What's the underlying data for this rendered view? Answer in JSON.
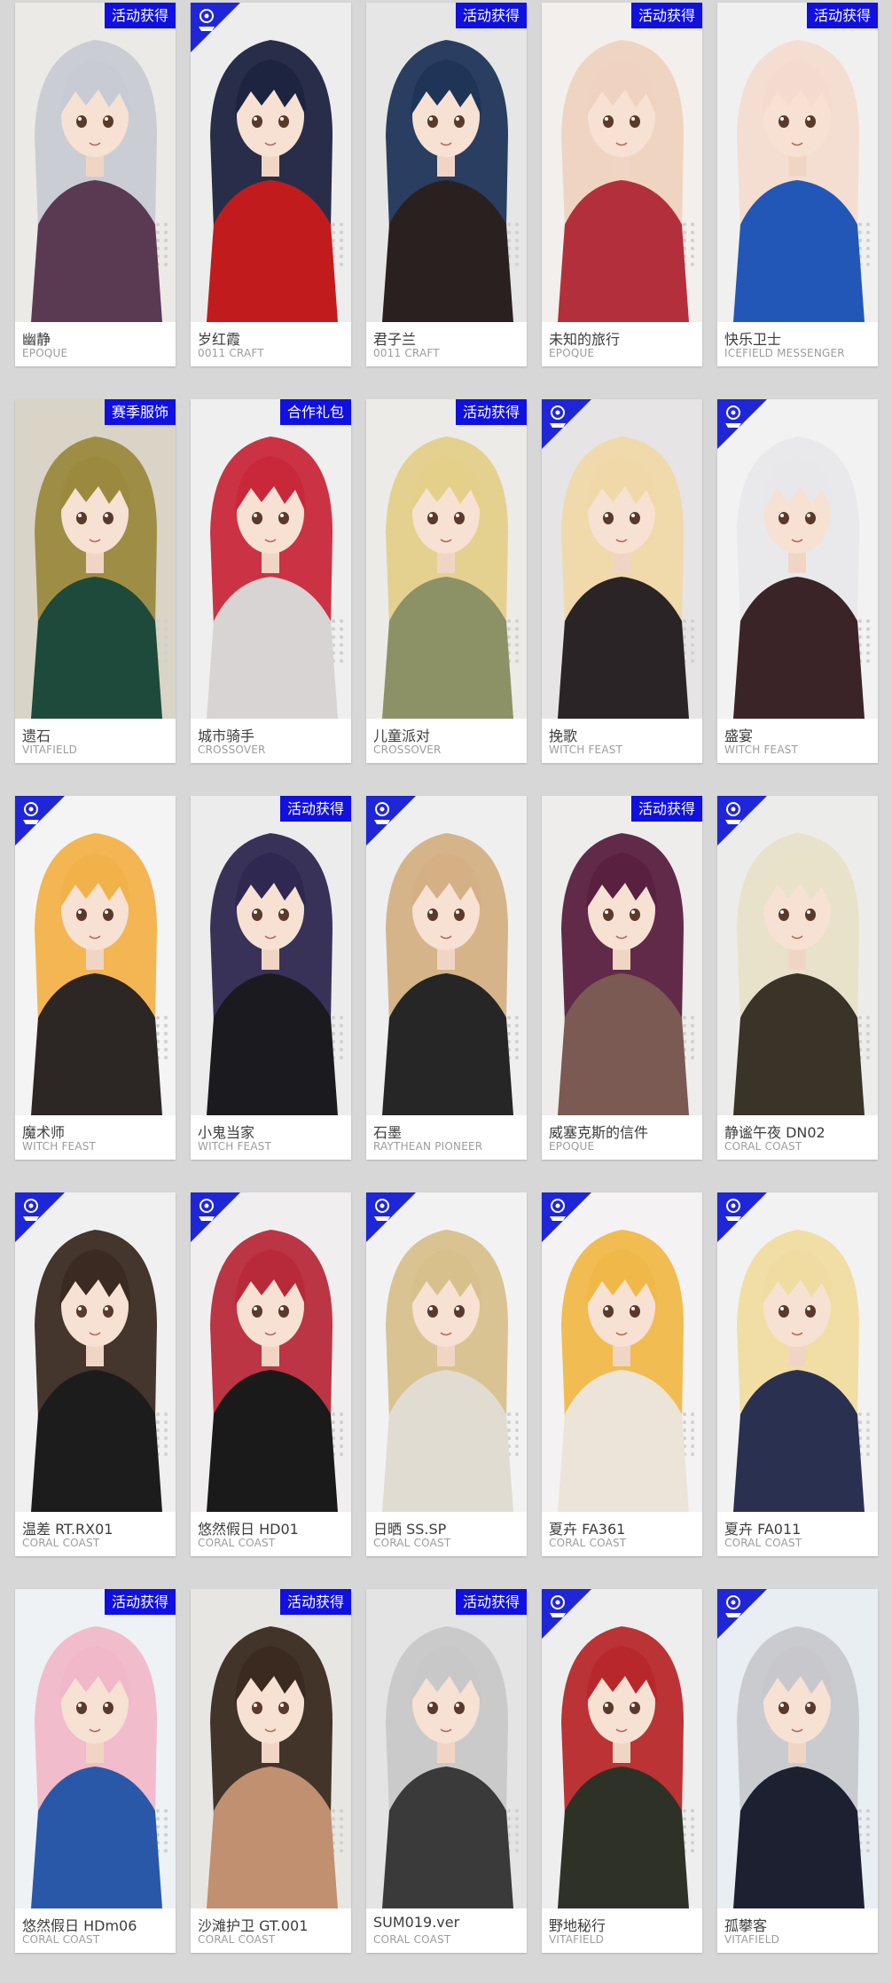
{
  "colors": {
    "badge_blue": "#1010e0",
    "corner_blue": "#1f26d8",
    "background": "#d7d7d7"
  },
  "skins": [
    {
      "name": "幽静",
      "brand": "EPOQUE",
      "badge": "活动获得",
      "corner_icon": false,
      "palette": {
        "bg": "#eceae6",
        "hair": "#c9cbd4",
        "outfit": "#5a3a52"
      }
    },
    {
      "name": "岁红霞",
      "brand": "0011 CRAFT",
      "badge": "",
      "corner_icon": true,
      "palette": {
        "bg": "#ededed",
        "hair": "#1d2440",
        "outfit": "#c21b1e"
      }
    },
    {
      "name": "君子兰",
      "brand": "0011 CRAFT",
      "badge": "活动获得",
      "corner_icon": false,
      "palette": {
        "bg": "#e6e6e6",
        "hair": "#1f3558",
        "outfit": "#2a2020"
      }
    },
    {
      "name": "未知的旅行",
      "brand": "EPOQUE",
      "badge": "活动获得",
      "corner_icon": false,
      "palette": {
        "bg": "#f2efec",
        "hair": "#efd2c0",
        "outfit": "#b42f3c"
      }
    },
    {
      "name": "快乐卫士",
      "brand": "ICEFIELD MESSENGER",
      "badge": "活动获得",
      "corner_icon": false,
      "palette": {
        "bg": "#f0f0f0",
        "hair": "#f3dccf",
        "outfit": "#2257b8"
      }
    },
    {
      "name": "遗石",
      "brand": "VITAFIELD",
      "badge": "赛季服饰",
      "corner_icon": false,
      "palette": {
        "bg": "#d9d4c6",
        "hair": "#9b8a3e",
        "outfit": "#1d4a3a"
      }
    },
    {
      "name": "城市骑手",
      "brand": "CROSSOVER",
      "badge": "合作礼包",
      "corner_icon": false,
      "palette": {
        "bg": "#efefef",
        "hair": "#c8283a",
        "outfit": "#d8d4d4"
      }
    },
    {
      "name": "儿童派对",
      "brand": "CROSSOVER",
      "badge": "活动获得",
      "corner_icon": false,
      "palette": {
        "bg": "#ecebe8",
        "hair": "#e5d08a",
        "outfit": "#8d9166"
      }
    },
    {
      "name": "挽歌",
      "brand": "WITCH FEAST",
      "badge": "",
      "corner_icon": true,
      "palette": {
        "bg": "#e6e4e4",
        "hair": "#f0d8a8",
        "outfit": "#2a2426"
      }
    },
    {
      "name": "盛宴",
      "brand": "WITCH FEAST",
      "badge": "",
      "corner_icon": true,
      "palette": {
        "bg": "#f2f2f2",
        "hair": "#e8e8ea",
        "outfit": "#3a2428"
      }
    },
    {
      "name": "魔术师",
      "brand": "WITCH FEAST",
      "badge": "",
      "corner_icon": true,
      "palette": {
        "bg": "#f4f4f4",
        "hair": "#f2b24a",
        "outfit": "#2c2624"
      }
    },
    {
      "name": "小鬼当家",
      "brand": "WITCH FEAST",
      "badge": "活动获得",
      "corner_icon": false,
      "palette": {
        "bg": "#ececec",
        "hair": "#2f2850",
        "outfit": "#1b1b1f"
      }
    },
    {
      "name": "石墨",
      "brand": "RAYTHEAN PIONEER",
      "badge": "",
      "corner_icon": true,
      "palette": {
        "bg": "#efefef",
        "hair": "#d4b084",
        "outfit": "#262626"
      }
    },
    {
      "name": "威塞克斯的信件",
      "brand": "EPOQUE",
      "badge": "活动获得",
      "corner_icon": false,
      "palette": {
        "bg": "#efecec",
        "hair": "#5a2040",
        "outfit": "#7a5a52"
      }
    },
    {
      "name": "静谧午夜 DN02",
      "brand": "CORAL COAST",
      "badge": "",
      "corner_icon": true,
      "palette": {
        "bg": "#ececea",
        "hair": "#e8e2c8",
        "outfit": "#3a3328"
      }
    },
    {
      "name": "温差 RT.RX01",
      "brand": "CORAL COAST",
      "badge": "",
      "corner_icon": true,
      "palette": {
        "bg": "#f0f0f0",
        "hair": "#3a2a22",
        "outfit": "#1c1c1c"
      }
    },
    {
      "name": "悠然假日 HD01",
      "brand": "CORAL COAST",
      "badge": "",
      "corner_icon": true,
      "palette": {
        "bg": "#f0eeee",
        "hair": "#b82a3a",
        "outfit": "#1a1a1a"
      }
    },
    {
      "name": "日晒 SS.SP",
      "brand": "CORAL COAST",
      "badge": "",
      "corner_icon": true,
      "palette": {
        "bg": "#f2f2f2",
        "hair": "#d8c08c",
        "outfit": "#e0dcd2"
      }
    },
    {
      "name": "夏卉 FA361",
      "brand": "CORAL COAST",
      "badge": "",
      "corner_icon": true,
      "palette": {
        "bg": "#f4f2f2",
        "hair": "#f0b848",
        "outfit": "#ece4d8"
      }
    },
    {
      "name": "夏卉 FA011",
      "brand": "CORAL COAST",
      "badge": "",
      "corner_icon": true,
      "palette": {
        "bg": "#f2f2f2",
        "hair": "#f0dca0",
        "outfit": "#2a3050"
      }
    },
    {
      "name": "悠然假日 HDm06",
      "brand": "CORAL COAST",
      "badge": "活动获得",
      "corner_icon": false,
      "palette": {
        "bg": "#eef2f4",
        "hair": "#f0b8c8",
        "outfit": "#2a58a8"
      }
    },
    {
      "name": "沙滩护卫 GT.001",
      "brand": "CORAL COAST",
      "badge": "活动获得",
      "corner_icon": false,
      "palette": {
        "bg": "#e8e6e2",
        "hair": "#3a2a20",
        "outfit": "#c09070"
      }
    },
    {
      "name": "SUM019.ver",
      "brand": "CORAL COAST",
      "badge": "活动获得",
      "corner_icon": false,
      "palette": {
        "bg": "#e4e4e4",
        "hair": "#c8c8c8",
        "outfit": "#3a3a3a"
      }
    },
    {
      "name": "野地秘行",
      "brand": "VITAFIELD",
      "badge": "",
      "corner_icon": true,
      "palette": {
        "bg": "#eeeeee",
        "hair": "#b8282a",
        "outfit": "#2e3226"
      }
    },
    {
      "name": "孤攀客",
      "brand": "VITAFIELD",
      "badge": "",
      "corner_icon": true,
      "palette": {
        "bg": "#e8eef2",
        "hair": "#c8c8cc",
        "outfit": "#1c2030"
      }
    }
  ]
}
